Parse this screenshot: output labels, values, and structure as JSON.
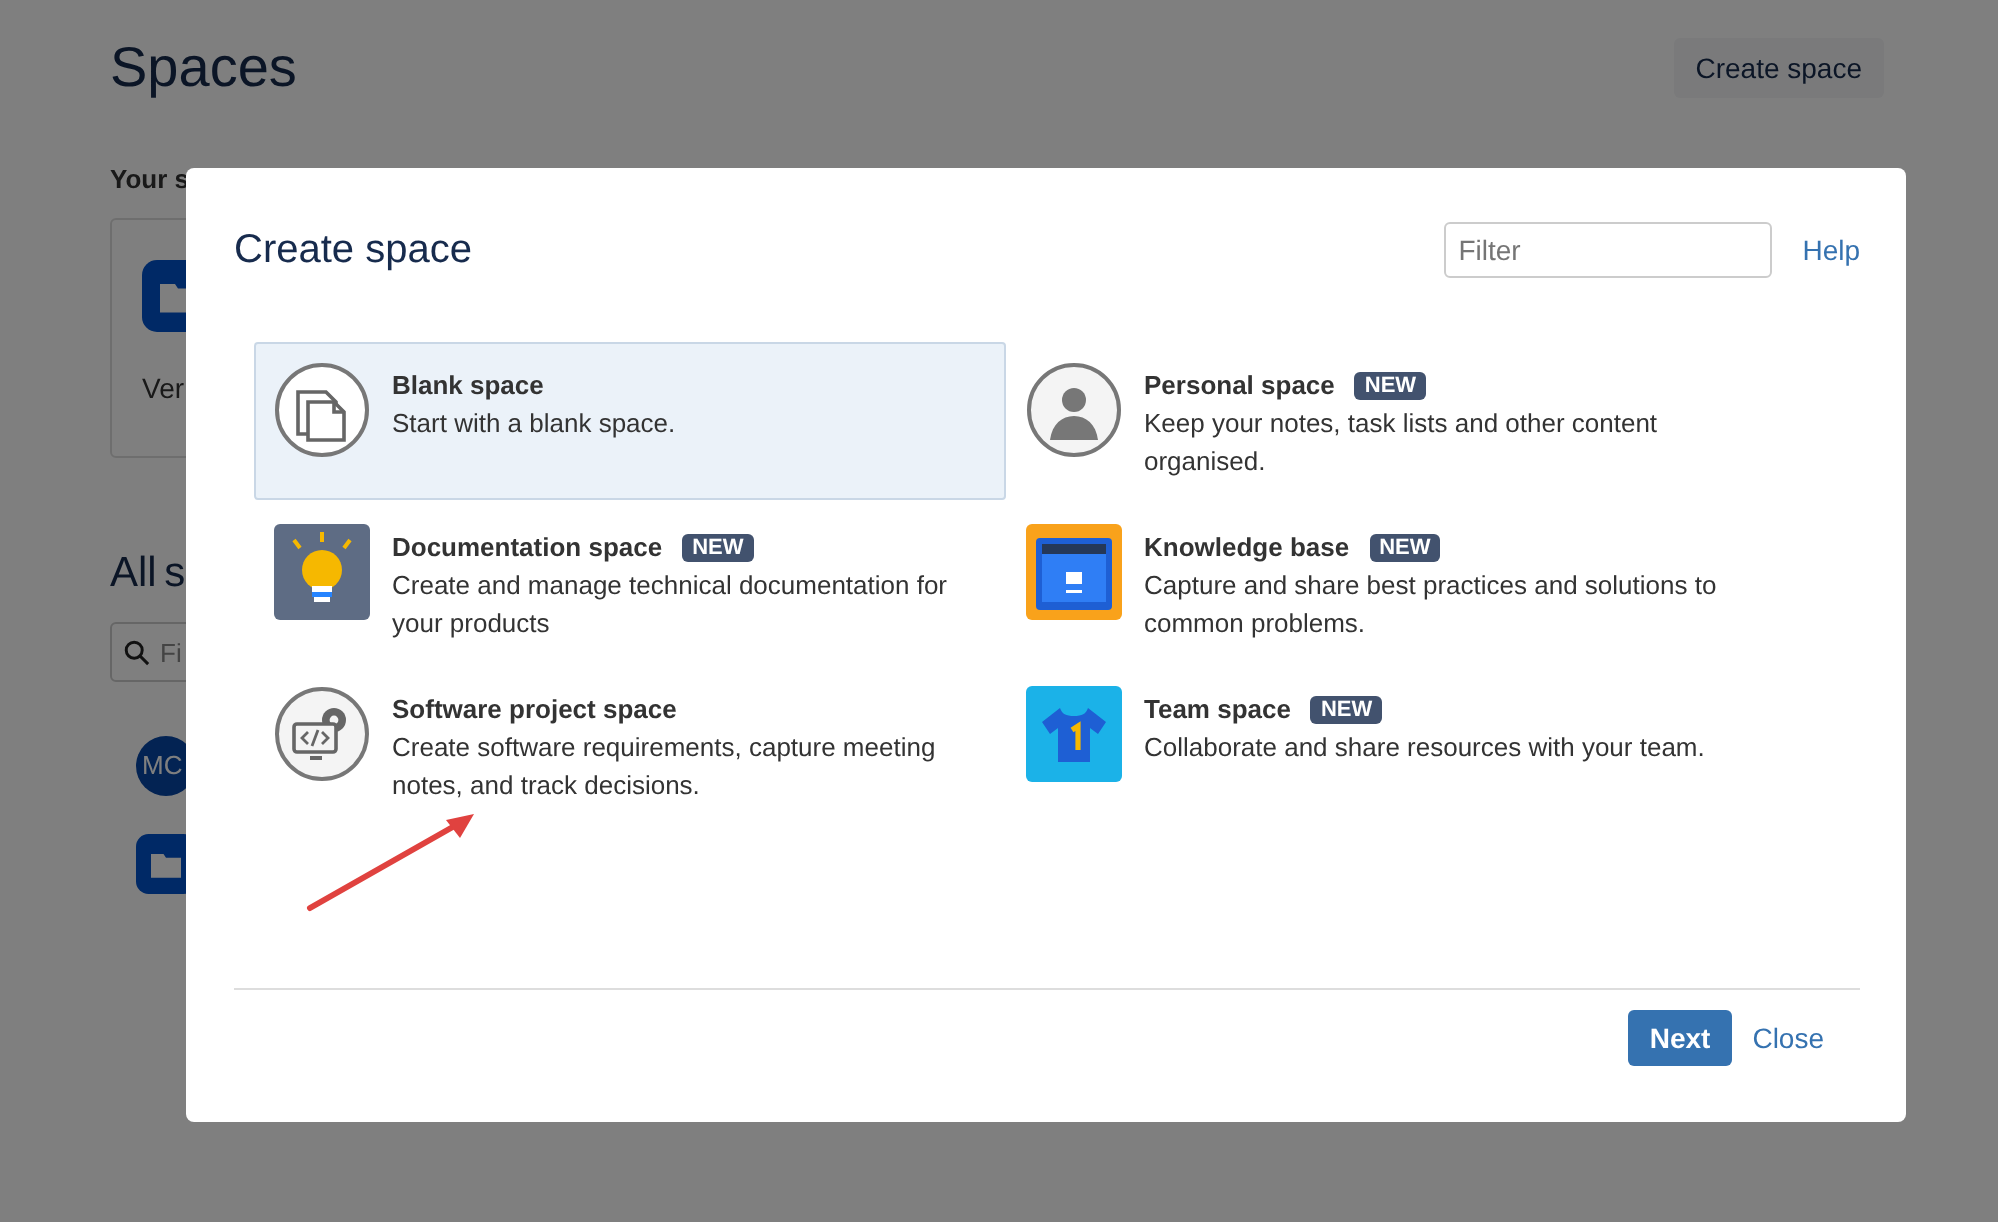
{
  "page": {
    "title": "Spaces",
    "create_button": "Create space",
    "your_spaces_label": "Your s",
    "card_text": "Ver",
    "all_spaces_label": "All s",
    "filter_placeholder": "Fi",
    "avatar_initials": "MC"
  },
  "dialog": {
    "title": "Create space",
    "filter_placeholder": "Filter",
    "help_link": "Help",
    "templates": [
      {
        "kind": "blank",
        "title": "Blank space",
        "description": "Start with a blank space.",
        "selected": true
      },
      {
        "kind": "personal",
        "title": "Personal space",
        "badge": "NEW",
        "description": "Keep your notes, task lists and other content organised.",
        "selected": false
      },
      {
        "kind": "documentation",
        "title": "Documentation space",
        "badge": "NEW",
        "description": "Create and manage technical documentation for your products",
        "selected": false
      },
      {
        "kind": "knowledge",
        "title": "Knowledge base",
        "badge": "NEW",
        "description": "Capture and share best practices and solutions to common problems.",
        "selected": false
      },
      {
        "kind": "software",
        "title": "Software project space",
        "description": "Create software requirements, capture meeting notes, and track decisions.",
        "selected": false
      },
      {
        "kind": "team",
        "title": "Team space",
        "badge": "NEW",
        "description": "Collaborate and share resources with your team.",
        "selected": false
      }
    ],
    "next_button": "Next",
    "close_link": "Close"
  }
}
